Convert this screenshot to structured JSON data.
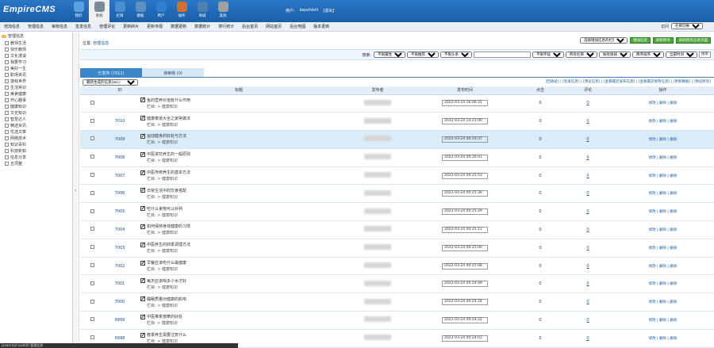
{
  "header": {
    "logo": "EmpireCMS",
    "nav": [
      {
        "label": "我的",
        "color": "#5aa0e0"
      },
      {
        "label": "系统",
        "color": "#7a8a9a"
      },
      {
        "label": "栏目",
        "color": "#4a90d0"
      },
      {
        "label": "模板",
        "color": "#6090c0"
      },
      {
        "label": "用户",
        "color": "#2f80d0"
      },
      {
        "label": "插件",
        "color": "#d07030"
      },
      {
        "label": "商城",
        "color": "#5080b0"
      },
      {
        "label": "其他",
        "color": "#a0a0a0"
      }
    ],
    "user_label": "用户:",
    "user_name": "baozhishi",
    "logout": "[退出]"
  },
  "menubar": {
    "items": [
      "增加信息",
      "管理信息",
      "审核信息",
      "签发信息",
      "管理评论",
      "更新碎片",
      "更新专题",
      "数据更新",
      "数据统计",
      "排行统计",
      "后台首页",
      "网站首页",
      "后台地图",
      "版本更新"
    ],
    "right_label": "访问",
    "right_select": "栏目切换"
  },
  "sidebar": {
    "root": "管理信息",
    "items": [
      "教师生活",
      "快乐教师",
      "文化漫谈",
      "我要学习",
      "美好一生",
      "职场资讯",
      "游戏世界",
      "生活常识",
      "美食健康",
      "开心趣事",
      "健康知识",
      "文史知识",
      "智慧达人",
      "精选资讯",
      "优选文章",
      "网络技术",
      "知识百科",
      "科技新知",
      "信息分享",
      "五项整"
    ]
  },
  "main": {
    "location_label": "位置:",
    "location_value": "管理信息",
    "select_channel": "选择增加信息的栏目",
    "btn_add": "增加信息",
    "btn_column": "刷新所有",
    "btn_refresh": "刷新所有信息页面",
    "search_label": "搜索:",
    "search_selects": [
      "不限属性",
      "不限推荐",
      "不限头条"
    ],
    "search_selects2": [
      "不限字段",
      "所有栏目",
      "按优值排",
      "降序排序",
      "全部时间"
    ],
    "search_btn": "搜索",
    "tab_published": "已发布 (7011)",
    "tab_pending": "待审核 (0)",
    "sort_select": "最新生成的信息(asc)",
    "top_links": "[回收站] | [签发信息] | [预览信息] | [查看最近发布信息] | [查看最近修改信息] | [更新数据] | [预览所有]",
    "columns": {
      "id": "ID",
      "title": "标题",
      "publisher": "发布者",
      "time": "发布时间",
      "clicks": "点击",
      "comments": "评论",
      "ops": "操作"
    },
    "rows": [
      {
        "id": "",
        "title": "鱼的营养价值有什么作用",
        "cat": "栏目: > 健康知识",
        "time": "2022-03-24 16:06:31",
        "clicks": "0",
        "comments": "0",
        "ops": "修改 | 删除 | 删除"
      },
      {
        "id": "7010",
        "title": "健康菜谱大全之家常做法",
        "cat": "栏目: > 健康知识",
        "time": "2022-03-24 14:21:00",
        "clicks": "0",
        "comments": "0",
        "ops": "修改 | 删除 | 删除"
      },
      {
        "id": "7009",
        "title": "运动健身的好处与方法",
        "cat": "栏目: > 健康知识",
        "time": "2022-03-24 00:26:37",
        "clicks": "0",
        "comments": "0",
        "ops": "修改 | 删除 | 删除"
      },
      {
        "id": "7008",
        "title": "中医讲究养生的一般原则",
        "cat": "栏目: > 健康知识",
        "time": "2022-03-24 00:26:01",
        "clicks": "0",
        "comments": "0",
        "ops": "修改 | 删除 | 删除"
      },
      {
        "id": "7007",
        "title": "中医传统养生的基本方法",
        "cat": "栏目: > 健康知识",
        "time": "2022-03-24 00:25:53",
        "clicks": "0",
        "comments": "0",
        "ops": "修改 | 删除 | 删除"
      },
      {
        "id": "7006",
        "title": "日常生活中的饮食搭配",
        "cat": "栏目: > 健康知识",
        "time": "2022-03-24 00:25:36",
        "clicks": "0",
        "comments": "0",
        "ops": "修改 | 删除 | 删除"
      },
      {
        "id": "7005",
        "title": "吃什么食物可以补钙",
        "cat": "栏目: > 健康知识",
        "time": "2022-03-24 00:25:29",
        "clicks": "0",
        "comments": "0",
        "ops": "修改 | 删除 | 删除"
      },
      {
        "id": "7004",
        "title": "如何保持身体健康的习惯",
        "cat": "栏目: > 健康知识",
        "time": "2022-03-24 00:25:12",
        "clicks": "0",
        "comments": "0",
        "ops": "修改 | 删除 | 删除"
      },
      {
        "id": "7003",
        "title": "中医养生的四季调理方法",
        "cat": "栏目: > 健康知识",
        "time": "2022-03-24 00:25:00",
        "clicks": "0",
        "comments": "0",
        "ops": "修改 | 删除 | 删除"
      },
      {
        "id": "7002",
        "title": "早餐应该吃什么最健康",
        "cat": "栏目: > 健康知识",
        "time": "2022-03-24 00:25:08",
        "clicks": "0",
        "comments": "0",
        "ops": "修改 | 删除 | 删除"
      },
      {
        "id": "7001",
        "title": "每天应该喝多少水才好",
        "cat": "栏目: > 健康知识",
        "time": "2022-03-24 00:24:49",
        "clicks": "0",
        "comments": "0",
        "ops": "修改 | 删除 | 删除"
      },
      {
        "id": "7000",
        "title": "睡眠质量对健康的影响",
        "cat": "栏目: > 健康知识",
        "time": "2022-03-24 00:24:24",
        "clicks": "0",
        "comments": "0",
        "ops": "修改 | 删除 | 删除"
      },
      {
        "id": "6999",
        "title": "中医推拿按摩的好处",
        "cat": "栏目: > 健康知识",
        "time": "2022-03-24 00:24:22",
        "clicks": "0",
        "comments": "0",
        "ops": "修改 | 删除 | 删除"
      },
      {
        "id": "6998",
        "title": "春季养生需要注意什么",
        "cat": "栏目: > 健康知识",
        "time": "2022-03-24 00:24:03",
        "clicks": "0",
        "comments": "0",
        "ops": "修改 | 删除 | 删除"
      }
    ]
  },
  "status": "javascript:void(0) 管理信息"
}
